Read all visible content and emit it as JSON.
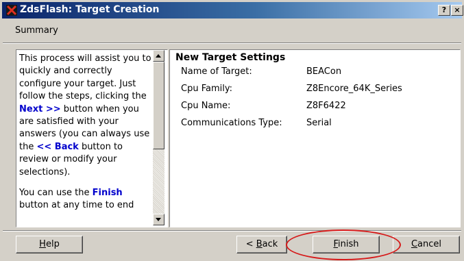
{
  "window": {
    "title": "ZdsFlash: Target Creation",
    "help_glyph": "?",
    "close_glyph": "×"
  },
  "header": {
    "summary": "Summary"
  },
  "info": {
    "p1_part1": "This process will assist you to quickly and correctly configure your target. Just follow the steps, clicking the ",
    "next_kw": "Next >>",
    "p1_part2": " button when you are satisfied with your answers (you can always use the ",
    "back_kw": "<< Back",
    "p1_part3": " button to review or modify your selections).",
    "p2_part1": "You can use the ",
    "finish_kw": "Finish",
    "p2_part2": " button at any time to end"
  },
  "settings": {
    "title": "New Target Settings",
    "rows": [
      {
        "label": "Name of Target:",
        "value": "BEACon"
      },
      {
        "label": "Cpu Family:",
        "value": "Z8Encore_64K_Series"
      },
      {
        "label": "Cpu Name:",
        "value": "Z8F6422"
      },
      {
        "label": "Communications Type:",
        "value": "Serial"
      }
    ]
  },
  "buttons": {
    "help_u": "H",
    "help_rest": "elp",
    "back_pre": "< ",
    "back_u": "B",
    "back_rest": "ack",
    "finish_u": "F",
    "finish_rest": "inish",
    "cancel_u": "C",
    "cancel_rest": "ancel"
  },
  "colors": {
    "title_gradient_start": "#0a246a",
    "title_gradient_end": "#a6caf0",
    "keyword_blue": "#0000cc",
    "annotation_red": "#d61a1a"
  }
}
